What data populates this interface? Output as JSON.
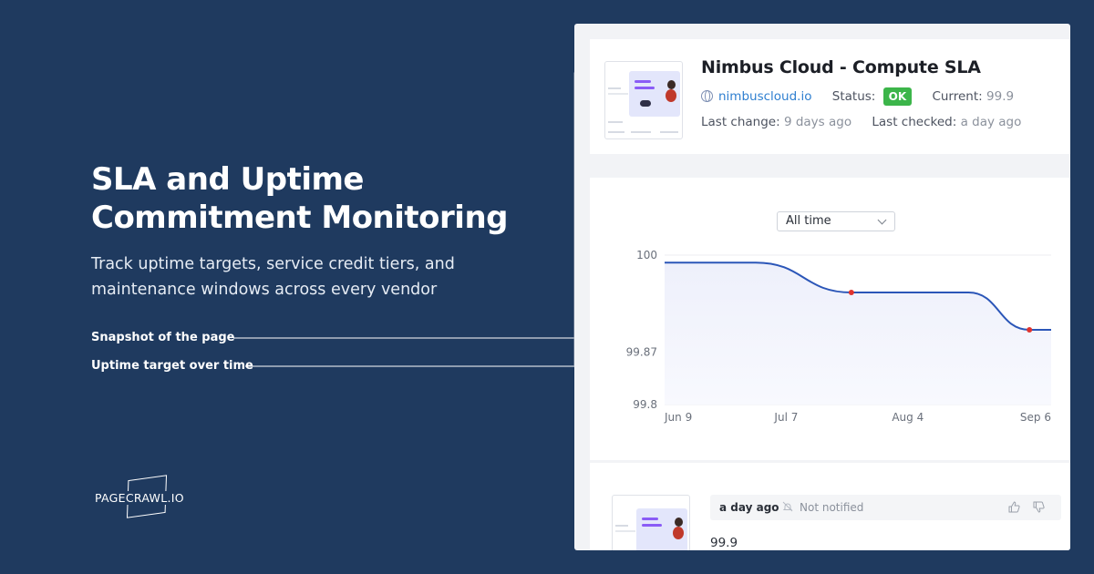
{
  "hero": {
    "title": "SLA and Uptime Commitment Monitoring",
    "subtitle": "Track uptime targets, service credit tiers, and maintenance windows across every vendor"
  },
  "callouts": {
    "snapshot": "Snapshot of the page",
    "chart": "Uptime target over time"
  },
  "brand": {
    "name": "PAGECRAWL.IO"
  },
  "monitor": {
    "title": "Nimbus Cloud - Compute SLA",
    "url": "nimbuscloud.io",
    "status_label": "Status:",
    "status_value": "OK",
    "current_label": "Current:",
    "current_value": "99.9",
    "last_change_label": "Last change:",
    "last_change_value": "9 days ago",
    "last_checked_label": "Last checked:",
    "last_checked_value": "a day ago"
  },
  "chart_controls": {
    "range": "All time"
  },
  "chart_data": {
    "type": "area",
    "x": [
      "Jun 9",
      "Jul 7",
      "Aug 4",
      "Sep 6"
    ],
    "x_ticks": [
      "Jun 9",
      "Jul 7",
      "Aug 4",
      "Sep 6"
    ],
    "y_ticks": [
      "100",
      "99.87",
      "99.8"
    ],
    "ylim": [
      99.8,
      100
    ],
    "series": [
      {
        "values": [
          {
            "x": "Jun 9",
            "y": 99.99
          },
          {
            "x": "Jun 30",
            "y": 99.99
          },
          {
            "x": "Jul 22",
            "y": 99.95
          },
          {
            "x": "Aug 18",
            "y": 99.95
          },
          {
            "x": "Sep 1",
            "y": 99.9
          },
          {
            "x": "Sep 6",
            "y": 99.9
          }
        ]
      }
    ],
    "change_points": [
      "Jul 22",
      "Sep 1"
    ],
    "colors": {
      "line": "#2b56b8",
      "fill": "#eef0fb",
      "marker": "#e0342e"
    },
    "grid": true
  },
  "history": {
    "entries": [
      {
        "time": "a day ago",
        "notification": "Not notified",
        "value": "99.9"
      }
    ]
  },
  "icons": [
    "globe-icon",
    "chevron-down-icon",
    "bell-off-icon",
    "thumbs-up-icon",
    "thumbs-down-icon"
  ]
}
